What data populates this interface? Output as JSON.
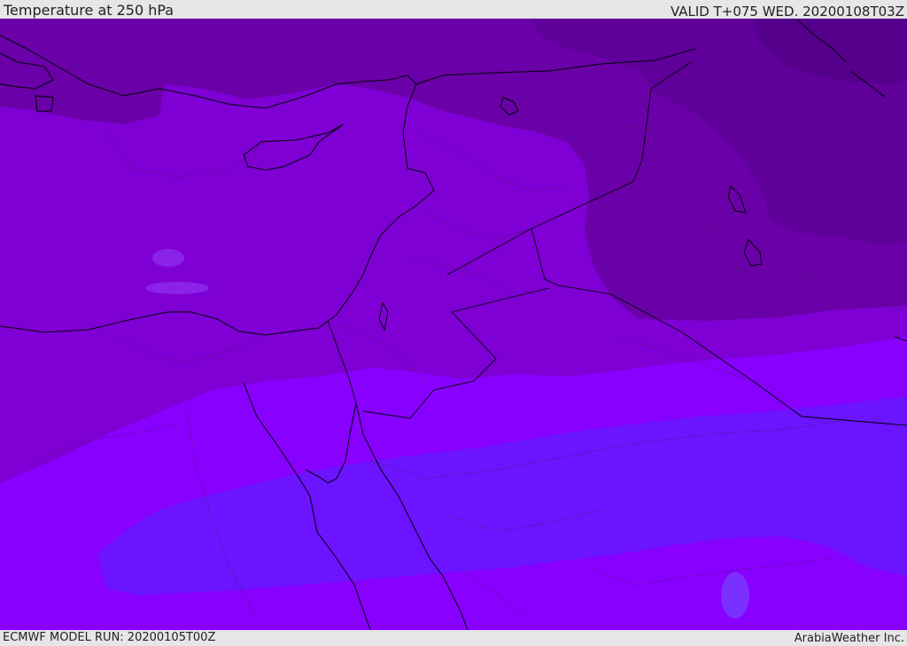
{
  "header": {
    "title": "Temperature at 250 hPa",
    "valid_time": "VALID T+075 WED. 20200108T03Z"
  },
  "footer": {
    "model_run": "ECMWF MODEL RUN: 20200105T00Z",
    "credit": "ArabiaWeather Inc."
  },
  "colors": {
    "band_darkest": "#5e0099",
    "band_dark": "#6a00a8",
    "band_mid": "#7a10c2",
    "band_main": "#7e00d4",
    "band_light": "#8200ee",
    "band_bright": "#8800ff",
    "band_blue": "#6a14ff",
    "band_pale_blue": "#7222ff",
    "coastline": "#000000",
    "frame": "#e6e6e6"
  }
}
